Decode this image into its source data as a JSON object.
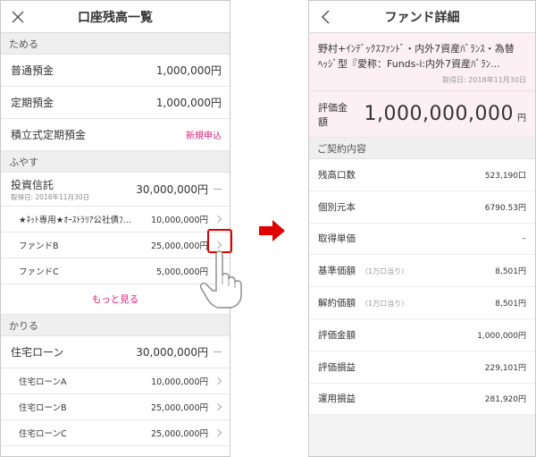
{
  "left": {
    "title": "口座残高一覧",
    "sections": {
      "tameru": "ためる",
      "fuyasu": "ふやす",
      "kariru": "かりる"
    },
    "tameru_rows": [
      {
        "label": "普通預金",
        "value": "1,000,000円"
      },
      {
        "label": "定期預金",
        "value": "1,000,000円"
      },
      {
        "label": "積立式定期預金",
        "value": "新規申込"
      }
    ],
    "investment": {
      "label": "投資信託",
      "date": "取得日: 2018年11月30日",
      "value": "30,000,000円"
    },
    "fund_rows": [
      {
        "label": "★ﾈｯﾄ専用★ｵｰｽﾄﾗﾘｱ公社債ﾌ...",
        "value": "10,000,000円"
      },
      {
        "label": "ファンドB",
        "value": "25,000,000円"
      },
      {
        "label": "ファンドC",
        "value": "5,000,000円"
      }
    ],
    "more_label": "もっと見る",
    "loan": {
      "label": "住宅ローン",
      "value": "30,000,000円"
    },
    "loan_rows": [
      {
        "label": "住宅ローンA",
        "value": "10,000,000円"
      },
      {
        "label": "住宅ローンB",
        "value": "25,000,000円"
      },
      {
        "label": "住宅ローンC",
        "value": "25,000,000円"
      }
    ]
  },
  "right": {
    "title": "ファンド詳細",
    "fund_name_line1": "野村+ｲﾝﾃﾞｯｸｽﾌｧﾝﾄﾞ・内外7資産ﾊﾞﾗﾝｽ・為替",
    "fund_name_line2": "ﾍｯｼﾞ型『愛称：Funds-i:内外7資産ﾊﾞﾗﾝ...",
    "date": "取得日: 2018年11月30日",
    "valuation_label": "評価金額",
    "valuation_value": "1,000,000,000",
    "valuation_unit": "円",
    "contract_section": "ご契約内容",
    "details": [
      {
        "label": "残高口数",
        "note": "",
        "value": "523,190口"
      },
      {
        "label": "個別元本",
        "note": "",
        "value": "6790.53円"
      },
      {
        "label": "取得単価",
        "note": "",
        "value": "–"
      },
      {
        "label": "基準価額",
        "note": "（1万口当り）",
        "value": "8,501円"
      },
      {
        "label": "解約価額",
        "note": "（1万口当り）",
        "value": "8,501円"
      },
      {
        "label": "評価金額",
        "note": "",
        "value": "1,000,000円"
      },
      {
        "label": "評価損益",
        "note": "",
        "value": "229,101円"
      },
      {
        "label": "運用損益",
        "note": "",
        "value": "281,920円"
      }
    ]
  },
  "colors": {
    "accent": "#e2227b",
    "highlight": "#e00000",
    "pink_bg": "#fdf0f4"
  },
  "icons": [
    "close-icon",
    "back-icon",
    "chevron-right-icon",
    "arrow-right-icon",
    "pointing-hand-icon"
  ]
}
